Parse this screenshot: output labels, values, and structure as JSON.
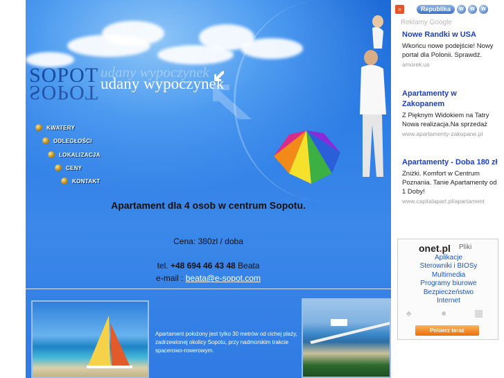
{
  "brand": {
    "title_main": "SOPOT",
    "title_sub": "udany wypoczynek",
    "title_ghost": "udany wypoczynek"
  },
  "menu": {
    "items": [
      {
        "label": "KWATERY"
      },
      {
        "label": "ODLEGŁOŚCI"
      },
      {
        "label": "LOKALIZACJA"
      },
      {
        "label": "CENY"
      },
      {
        "label": "KONTAKT"
      }
    ]
  },
  "content": {
    "headline": "Apartament dla 4 osob w centrum Sopotu.",
    "price": "Cena: 380zl / doba",
    "phone_prefix": "tel. ",
    "phone_number": "+48 694 46 43 48",
    "phone_name": " Beata",
    "email_prefix": "e-mail : ",
    "email": "beata@e-sopot.com",
    "description": "Apartament położony jest tylko 30 metrów od cichej plaży, zadrzewionej okolicy Sopotu, przy nadmorskim trakcie spacerowo-rowerowym."
  },
  "sidebar": {
    "toolbar": {
      "republika_label": "Republika",
      "www1": "W",
      "www2": "W",
      "www3": "W"
    },
    "ads_title": "Reklamy Google",
    "ads": [
      {
        "title": "Nowe Randki w USA",
        "body": "Wkońcu nowe podejście! Nowy portal dla Polonii. Sprawdź.",
        "url": "amorek.us"
      },
      {
        "title": "Apartamenty w Zakopanem",
        "body": "Z Pięknym Widokiem na Tatry Nowa realizacja.Na sprzedaż",
        "url": "www.apartamenty-zakopane.pl"
      },
      {
        "title": "Apartamenty - Doba 180 zł",
        "body": "Zniżki. Komfort w Centrum Poznania. Tanie Apartamenty od 1 Doby!",
        "url": "www.capitalapart.pl/apartament"
      }
    ],
    "onet": {
      "logo_left": "onet",
      "logo_dot": ".",
      "logo_right": "pl",
      "pliki": "Pliki",
      "links": [
        "Aplikacje",
        "Sterowniki i BIOSy",
        "Multimedia",
        "Programy biurowe",
        "Bezpieczeństwo",
        "Internet"
      ],
      "download": "Pobierz teraz"
    }
  },
  "colors": {
    "page_blue": "#2f7fe6",
    "ad_title": "#1b3fc4",
    "download": "#ea6e0c"
  }
}
